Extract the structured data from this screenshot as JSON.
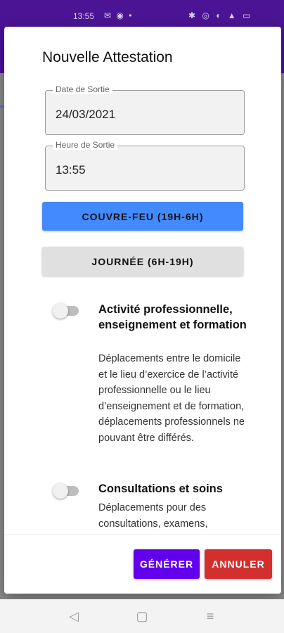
{
  "status_bar": {
    "time": "13:55",
    "left_icons": "✉ ◉ •",
    "right_icons": "✱ ◎ ◐ ▲ ▭"
  },
  "dialog": {
    "title": "Nouvelle Attestation",
    "date_field": {
      "label": "Date de Sortie",
      "value": "24/03/2021"
    },
    "time_field": {
      "label": "Heure de Sortie",
      "value": "13:55"
    },
    "curfew_button": "COUVRE-FEU (19H-6H)",
    "day_button": "JOURNÉE (6H-19H)",
    "reasons": [
      {
        "title": "Activité professionnelle, enseignement et formation",
        "description": "Déplacements entre le domicile et le lieu d’exercice de l’activité professionnelle ou le lieu d’enseignement et de formation, déplacements professionnels ne pouvant être différés.",
        "enabled": false
      },
      {
        "title": "Consultations et soins",
        "description": "Déplacements pour des consultations, examens,",
        "enabled": false
      }
    ],
    "generate_button": "GÉNÉRER",
    "cancel_button": "ANNULER"
  },
  "nav_bar": {
    "back_icon": "◁",
    "home_icon": "▢",
    "menu_icon": "≡"
  },
  "colors": {
    "app_bar": "#4b0fa0",
    "primary_button": "#448aff",
    "generate": "#6200ee",
    "cancel": "#d32f2f"
  }
}
